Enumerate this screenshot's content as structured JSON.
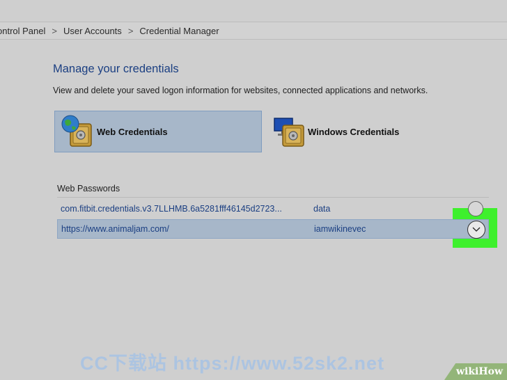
{
  "breadcrumb": {
    "items": [
      "ontrol Panel",
      "User Accounts",
      "Credential Manager"
    ],
    "separator": ">"
  },
  "page": {
    "title": "Manage your credentials",
    "description": "View and delete your saved logon information for websites, connected applications and networks."
  },
  "credential_types": [
    {
      "label": "Web Credentials",
      "icon": "web-credentials-icon",
      "selected": true
    },
    {
      "label": "Windows Credentials",
      "icon": "windows-credentials-icon",
      "selected": false
    }
  ],
  "web_passwords": {
    "label": "Web Passwords",
    "rows": [
      {
        "site": "com.fitbit.credentials.v3.7LLHMB.6a5281fff46145d2723...",
        "user": "data",
        "selected": false
      },
      {
        "site": "https://www.animaljam.com/",
        "user": "iamwikinevec",
        "selected": true
      }
    ]
  },
  "watermark": "CC下载站  https://www.52sk2.net",
  "badge": "wikiHow",
  "colors": {
    "background": "#cfcfcf",
    "selection": "#a7b7c9",
    "link_blue": "#1b3f82",
    "highlight_green": "#3ef02d"
  }
}
